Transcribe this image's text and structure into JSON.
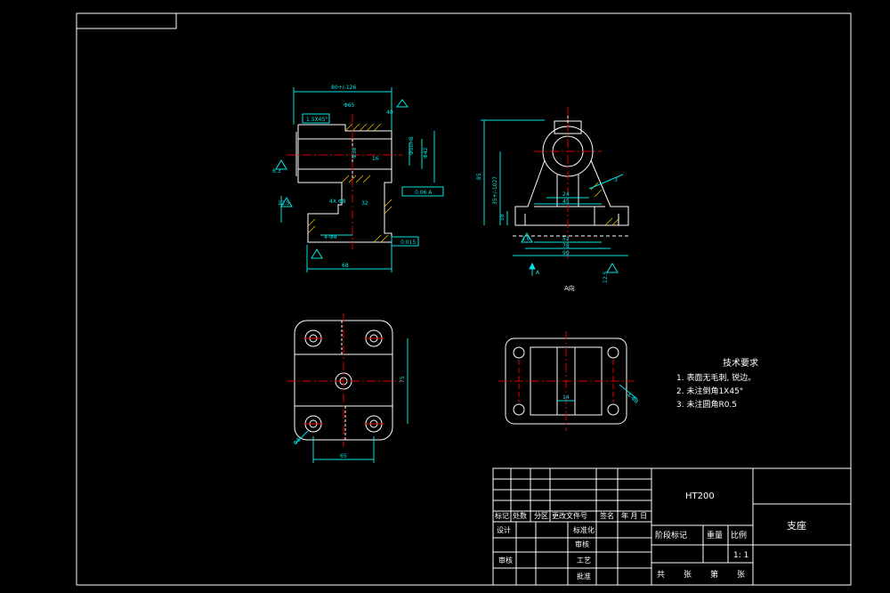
{
  "drawing": {
    "material": "HT200",
    "part_name": "支座",
    "scale": "1: 1",
    "view_label": "A向",
    "arrow_label": "A"
  },
  "tech_notes": {
    "title": "技术要求",
    "items": [
      "1. 表面无毛刺, 锐边。",
      "2. 未注倒角1X45°",
      "3. 未注圆角R0.5"
    ]
  },
  "title_block": {
    "row_labels": [
      "标记",
      "处数",
      "分区",
      "更改文件号",
      "签名",
      "年 月 日"
    ],
    "design": "设计",
    "standardize": "标准化",
    "review": "审核",
    "craft": "工艺",
    "approve": "批准",
    "process": "审核",
    "stage_label": "阶段标记",
    "weight_label": "重量",
    "scale_label": "比例",
    "sheets_total": "共",
    "sheets_unit": "张",
    "sheet_no": "第",
    "sheet_unit2": "张"
  },
  "dims": {
    "front_top": "80+/-126",
    "front_bore": "Φ65",
    "front_r": "40",
    "chamfer": "1.5X45°",
    "h_62": "6.3",
    "h_125": "12.5",
    "d_tol": "4X Φ8",
    "w_68": "68",
    "l_4_08": "4-Φ8",
    "par": "0.06 A",
    "par2": "0.015",
    "d_32": "32",
    "d_phi50": "Φ50H8",
    "d_phi42": "Φ42",
    "d_phi38": "Φ38",
    "d_16": "16",
    "side_85": "85",
    "side_33": "35+/-1027",
    "side_18": "18",
    "side_24": "24",
    "side_45": "45",
    "side_52": "52",
    "side_78": "78",
    "side_90": "90",
    "side_38": "3.6",
    "side_125": "12.5",
    "side_3": "3",
    "plan_75": "75",
    "plan_65": "65",
    "plan_8": "Φ8",
    "bot_14": "14",
    "bot_r8": "4-Φ8"
  }
}
